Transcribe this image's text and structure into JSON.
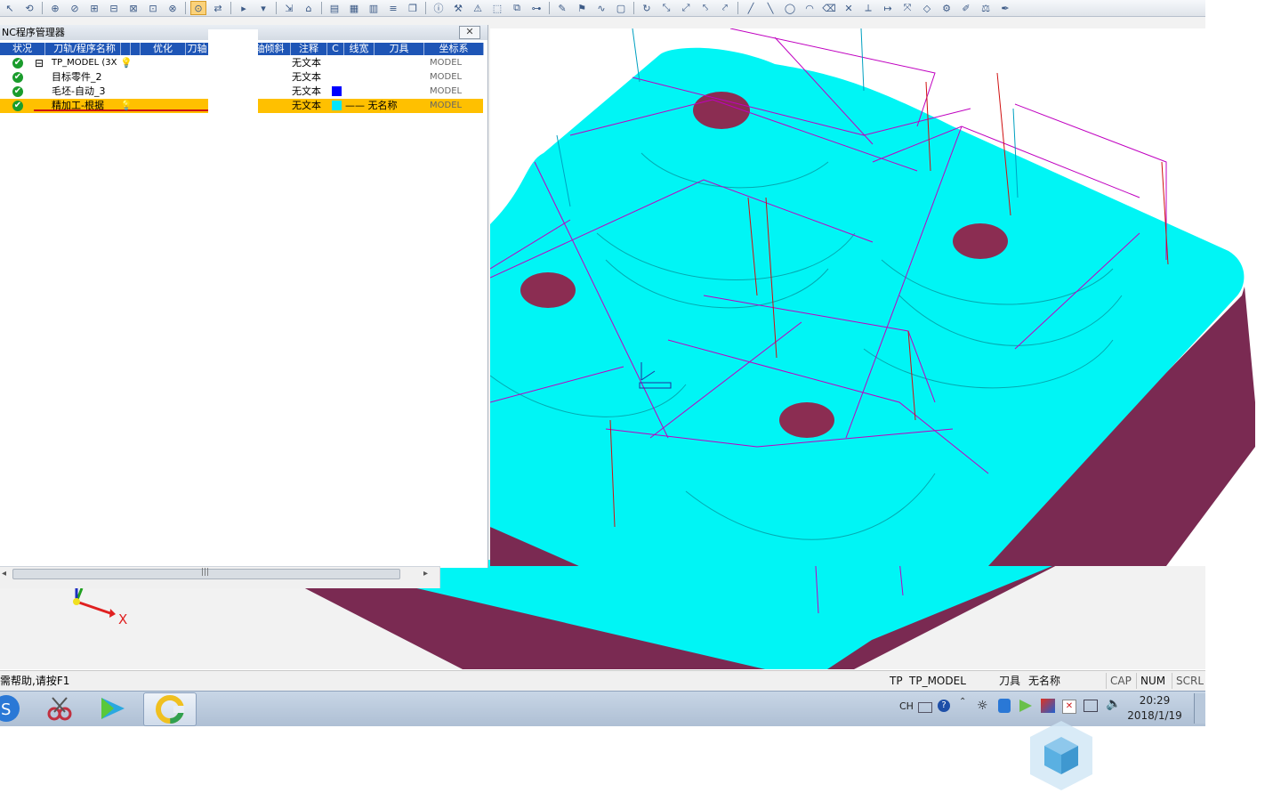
{
  "toolbar": {
    "buttons": [
      "select-icon",
      "path-icon",
      "filter-icon",
      "filter2-icon",
      "filter3-icon",
      "filter4-icon",
      "filter5-icon",
      "filter6-icon",
      "filter7-icon",
      "active-tool-icon",
      "reverse-icon",
      "select-mode-icon",
      "select2-icon",
      "move-icon",
      "funnel-icon",
      "machine-icon",
      "clipboard-icon",
      "list-icon",
      "align-icon",
      "doc-icon",
      "info-icon",
      "tool-icon",
      "warning-icon",
      "cube-icon",
      "copy-icon",
      "tree-icon",
      "sketch-icon",
      "flag-icon",
      "curve-icon",
      "box-icon",
      "rotate-icon",
      "axis-icon",
      "axis2-icon",
      "axis3-icon",
      "axis4-icon",
      "line-icon",
      "line2-icon",
      "circle-icon",
      "arc-icon",
      "eraser-icon",
      "cross-icon",
      "trim-icon",
      "extend-icon",
      "scale-icon",
      "shape-icon",
      "gear-icon",
      "brush-icon",
      "measure-icon",
      "pen-icon"
    ]
  },
  "nc_panel": {
    "title": "NC程序管理器",
    "close_label": "✕",
    "columns": [
      "状况",
      "刀轨/程序名称",
      "",
      "",
      "优化",
      "刀轴",
      "轴倾斜",
      "注释",
      "C",
      "线宽",
      "刀具",
      "坐标系"
    ],
    "rows": [
      {
        "status": "✔",
        "expander": "⊟",
        "name": "TP_MODEL (3X",
        "note": "无文本",
        "tool": "",
        "csys": "MODEL",
        "color": "",
        "bulb": true,
        "selected": false
      },
      {
        "status": "✔",
        "expander": "",
        "name": "目标零件_2",
        "note": "无文本",
        "tool": "",
        "csys": "MODEL",
        "color": "",
        "bulb": false,
        "selected": false
      },
      {
        "status": "✔",
        "expander": "",
        "name": "毛坯-自动_3",
        "note": "无文本",
        "tool": "",
        "csys": "MODEL",
        "color": "#0000ff",
        "bulb": false,
        "selected": false
      },
      {
        "status": "✔",
        "expander": "",
        "name": "精加工-根据",
        "note": "无文本",
        "tool": "—— 无名称",
        "csys": "MODEL",
        "color": "#00e5ff",
        "bulb": true,
        "selected": true
      }
    ],
    "scroll_grip": "|||",
    "scroll_left": "◂",
    "scroll_right": "▸"
  },
  "viewport": {
    "axis_label_x": "X",
    "model_color": "#00f5f5",
    "wall_color": "#7a2a52",
    "hole_color": "#8b2d52",
    "toolpath_color": "#c000c0",
    "plunge_color": "#d01010"
  },
  "statusbar": {
    "help_text": "需帮助,请按F1",
    "tp_label": "TP",
    "tp_value": "TP_MODEL",
    "tool_label": "刀具",
    "tool_value": "无名称",
    "cap": "CAP",
    "num": "NUM",
    "scrl": "SCRL"
  },
  "taskbar": {
    "apps": [
      "sogou-icon",
      "scissors-app-icon",
      "media-player-icon",
      "cam-app-icon"
    ],
    "tray": {
      "lang": "CH",
      "time": "20:29",
      "date": "2018/1/19"
    }
  },
  "colors": {
    "header_blue": "#1e55b6",
    "selection": "#ffc000",
    "panel_bg": "#ffffff"
  }
}
